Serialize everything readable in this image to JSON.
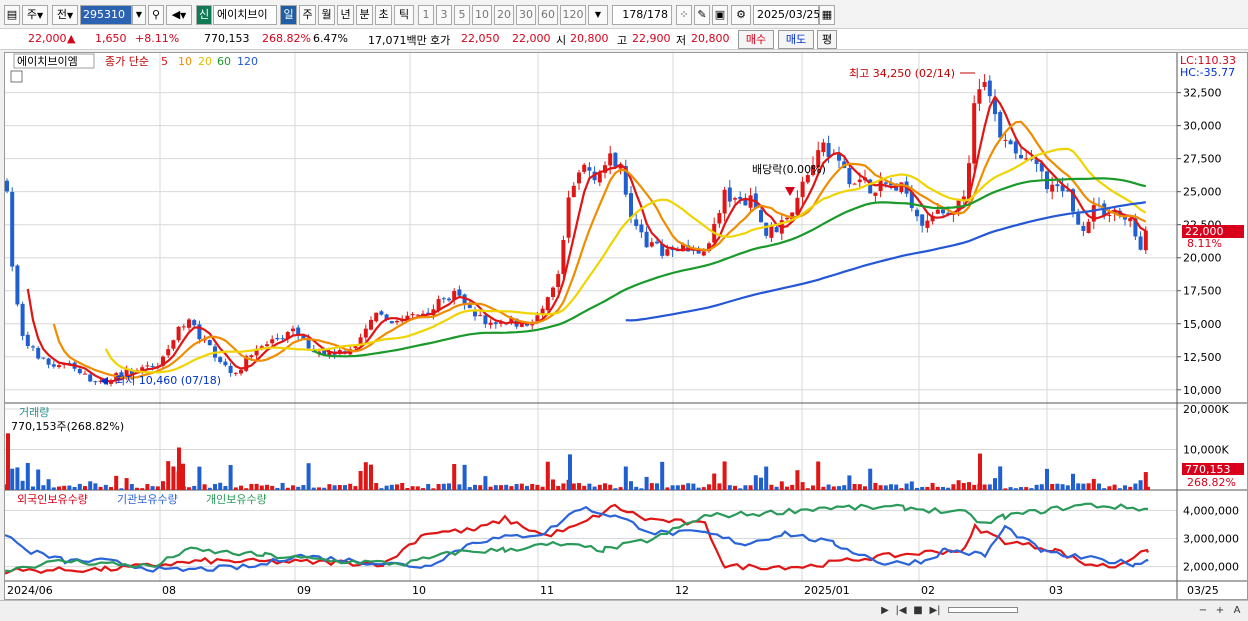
{
  "toolbar": {
    "period_mode": "주",
    "prev_label": "전",
    "code": "295310",
    "stock_name": "에이치브이",
    "credit_badge": "신",
    "tabs": [
      "일",
      "주",
      "월",
      "년",
      "분",
      "초",
      "틱"
    ],
    "active_tab": "일",
    "intervals": [
      "1",
      "3",
      "5",
      "10",
      "20",
      "30",
      "60",
      "120"
    ],
    "count": "178",
    "count_total": "/178",
    "date": "2025/03/25"
  },
  "quote": {
    "price": "22,000",
    "change_arrow": "▲",
    "change": "1,650",
    "change_pct": "+8.11%",
    "volume": "770,153",
    "volume_ratio": "268.82%",
    "turnover": "6.47%",
    "amount": "17,071백만",
    "bid_label": "호가",
    "bid": "22,050",
    "ask": "22,000",
    "open_label": "시",
    "open": "20,800",
    "high_label": "고",
    "high": "22,900",
    "low_label": "저",
    "low": "20,800",
    "buy_button": "매수",
    "sell_button": "매도",
    "eval_button": "평"
  },
  "legend": {
    "name": "에이치브이엠",
    "ma_label": "종가 단순",
    "ma_periods": [
      "5",
      "10",
      "20",
      "60",
      "120"
    ],
    "ma_colors": [
      "#e01515",
      "#f08c00",
      "#f0d400",
      "#1a9a2a",
      "#2457d6"
    ],
    "lc": "LC:110.33",
    "hc": "HC:-35.77"
  },
  "annotations": {
    "high": "최고 34,250 (02/14)",
    "low": "최저 10,460 (07/18)",
    "dividend": "배당락(0.00%)",
    "price_tag": "22,000",
    "pct_tag": "8.11%",
    "vol_label": "거래량",
    "vol_value": "770,153주(268.82%)",
    "vol_tag": "770,153",
    "vol_pct_tag": "268.82%",
    "holders": [
      "외국인보유수량",
      "기관보유수량",
      "개인보유수량"
    ],
    "holder_colors": [
      "#e01515",
      "#2b64d8",
      "#2a9a5a"
    ]
  },
  "chart_data": {
    "type": "candlestick",
    "price_axis": {
      "ticks": [
        "32,500",
        "30,000",
        "27,500",
        "25,000",
        "22,500",
        "20,000",
        "17,500",
        "15,000",
        "12,500",
        "10,000"
      ],
      "ylim": [
        9000,
        35500
      ]
    },
    "volume_axis": {
      "ticks": [
        "20,000K",
        "10,000K"
      ]
    },
    "holder_axis": {
      "ticks": [
        "4,000,000",
        "3,000,000",
        "2,000,000"
      ]
    },
    "x_labels": [
      "2024/06",
      "08",
      "09",
      "10",
      "11",
      "12",
      "2025/01",
      "02",
      "03",
      "03/25"
    ],
    "last_close": 22000,
    "period_high": 34250,
    "period_low": 10460
  },
  "bottom": {
    "controls": [
      "▶",
      "|◀",
      "■",
      "▶|",
      "−",
      "+",
      "A"
    ]
  }
}
